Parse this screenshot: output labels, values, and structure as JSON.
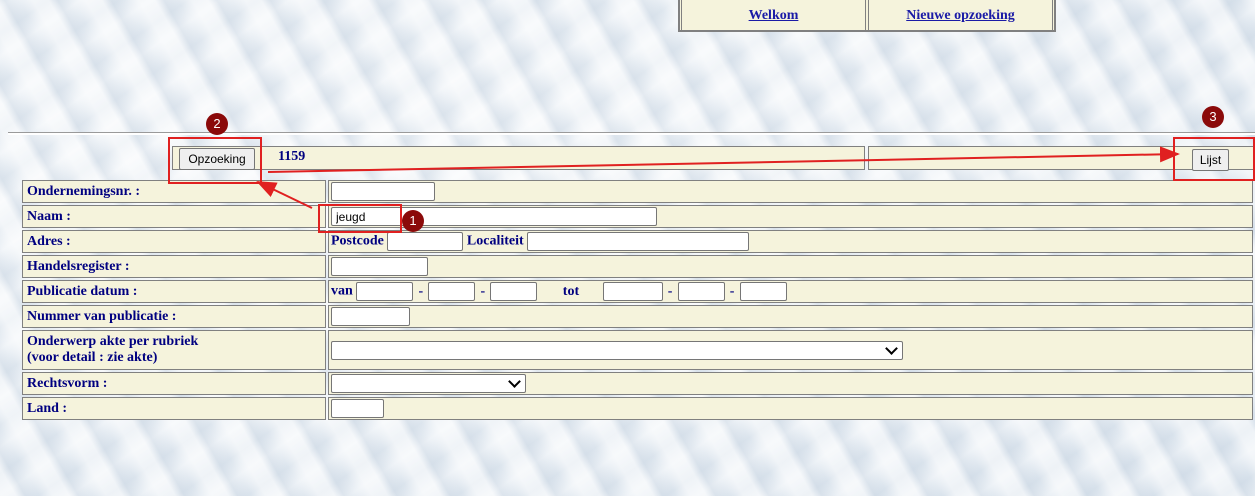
{
  "nav": {
    "welcome": "Welkom",
    "new_search": "Nieuwe opzoeking"
  },
  "header": {
    "search_button": "Opzoeking",
    "result_count": "1159",
    "list_button": "Lijst"
  },
  "form": {
    "company_number": {
      "label": "Ondernemingsnr. :",
      "value": ""
    },
    "name": {
      "label": "Naam :",
      "value": "jeugd"
    },
    "address": {
      "label": "Adres :",
      "postcode_label": "Postcode",
      "postcode_value": "",
      "locality_label": "Localiteit",
      "locality_value": ""
    },
    "trade_register": {
      "label": "Handelsregister :",
      "value": ""
    },
    "publication_date": {
      "label": "Publicatie datum :",
      "from_label": "van",
      "to_label": "tot",
      "separator": "-"
    },
    "publication_number": {
      "label": "Nummer van publicatie :",
      "value": ""
    },
    "subject": {
      "label_line1": "Onderwerp akte per rubriek",
      "label_line2": "(voor detail : zie akte)",
      "selected": ""
    },
    "legal_form": {
      "label": "Rechtsvorm :",
      "selected": ""
    },
    "country": {
      "label": "Land :",
      "value": ""
    }
  },
  "annotations": {
    "badge1": "1",
    "badge2": "2",
    "badge3": "3",
    "color": "#e02020",
    "badge_color": "#8b0a0a"
  },
  "colors": {
    "cell_background": "#f5f3dc",
    "label_text": "#000080",
    "link": "#1a1aa6"
  }
}
